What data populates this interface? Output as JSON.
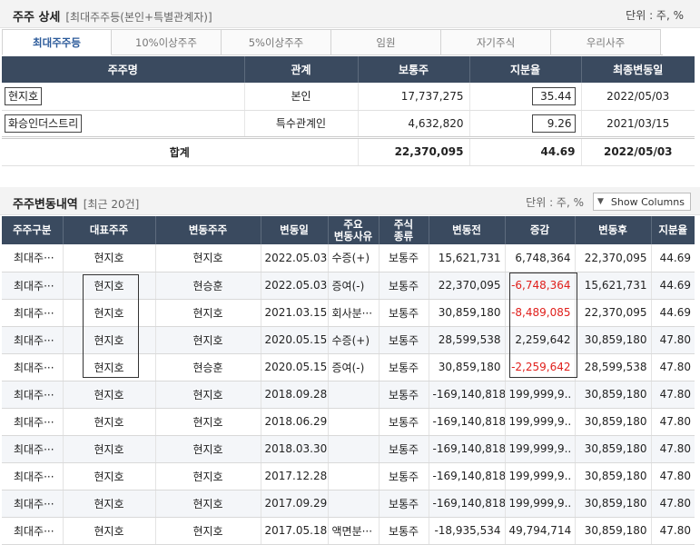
{
  "summary": {
    "title": "주주 상세",
    "subtitle": "[최대주주등(본인+특별관계자)]",
    "unit": "단위 : 주, %",
    "tabs": [
      "최대주주등",
      "10%이상주주",
      "5%이상주주",
      "임원",
      "자기주식",
      "우리사주"
    ],
    "columns": [
      "주주명",
      "관계",
      "보통주",
      "지분율",
      "최종변동일"
    ],
    "rows": [
      {
        "name": "현지호",
        "relation": "본인",
        "common": "17,737,275",
        "share": "35.44",
        "last_change": "2022/05/03"
      },
      {
        "name": "화승인더스트리",
        "relation": "특수관계인",
        "common": "4,632,820",
        "share": "9.26",
        "last_change": "2021/03/15"
      }
    ],
    "total": {
      "label": "합계",
      "common": "22,370,095",
      "share": "44.69",
      "last_change": "2022/05/03"
    }
  },
  "history": {
    "title": "주주변동내역",
    "subtitle": "[최근 20건]",
    "unit": "단위 : 주, %",
    "show_columns_label": "Show Columns",
    "columns": [
      "주주구분",
      "대표주주",
      "변동주주",
      "변동일",
      "주요\n변동사유",
      "주식\n종류",
      "변동전",
      "증감",
      "변동후",
      "지분율"
    ],
    "rows": [
      {
        "type": "최대주···",
        "rep": "현지호",
        "changer": "현지호",
        "date": "2022.05.03",
        "reason": "수증(+)",
        "kind": "보통주",
        "before": "15,621,731",
        "delta": "6,748,364",
        "after": "22,370,095",
        "share": "44.69"
      },
      {
        "type": "최대주···",
        "rep": "현지호",
        "changer": "현승훈",
        "date": "2022.05.03",
        "reason": "증여(-)",
        "kind": "보통주",
        "before": "22,370,095",
        "delta": "-6,748,364",
        "after": "15,621,731",
        "share": "44.69"
      },
      {
        "type": "최대주···",
        "rep": "현지호",
        "changer": "현지호",
        "date": "2021.03.15",
        "reason": "회사분···",
        "kind": "보통주",
        "before": "30,859,180",
        "delta": "-8,489,085",
        "after": "22,370,095",
        "share": "44.69"
      },
      {
        "type": "최대주···",
        "rep": "현지호",
        "changer": "현지호",
        "date": "2020.05.15",
        "reason": "수증(+)",
        "kind": "보통주",
        "before": "28,599,538",
        "delta": "2,259,642",
        "after": "30,859,180",
        "share": "47.80"
      },
      {
        "type": "최대주···",
        "rep": "현지호",
        "changer": "현승훈",
        "date": "2020.05.15",
        "reason": "증여(-)",
        "kind": "보통주",
        "before": "30,859,180",
        "delta": "-2,259,642",
        "after": "28,599,538",
        "share": "47.80"
      },
      {
        "type": "최대주···",
        "rep": "현지호",
        "changer": "현지호",
        "date": "2018.09.28",
        "reason": "",
        "kind": "보통주",
        "before": "-169,140,818",
        "delta": "199,999,9..",
        "after": "30,859,180",
        "share": "47.80"
      },
      {
        "type": "최대주···",
        "rep": "현지호",
        "changer": "현지호",
        "date": "2018.06.29",
        "reason": "",
        "kind": "보통주",
        "before": "-169,140,818",
        "delta": "199,999,9..",
        "after": "30,859,180",
        "share": "47.80"
      },
      {
        "type": "최대주···",
        "rep": "현지호",
        "changer": "현지호",
        "date": "2018.03.30",
        "reason": "",
        "kind": "보통주",
        "before": "-169,140,818",
        "delta": "199,999,9..",
        "after": "30,859,180",
        "share": "47.80"
      },
      {
        "type": "최대주···",
        "rep": "현지호",
        "changer": "현지호",
        "date": "2017.12.28",
        "reason": "",
        "kind": "보통주",
        "before": "-169,140,818",
        "delta": "199,999,9..",
        "after": "30,859,180",
        "share": "47.80"
      },
      {
        "type": "최대주···",
        "rep": "현지호",
        "changer": "현지호",
        "date": "2017.09.29",
        "reason": "",
        "kind": "보통주",
        "before": "-169,140,818",
        "delta": "199,999,9..",
        "after": "30,859,180",
        "share": "47.80"
      },
      {
        "type": "최대주···",
        "rep": "현지호",
        "changer": "현지호",
        "date": "2017.05.18",
        "reason": "액면분···",
        "kind": "보통주",
        "before": "-18,935,534",
        "delta": "49,794,714",
        "after": "30,859,180",
        "share": "47.80"
      }
    ]
  },
  "colors": {
    "header_bg": "#3a4a5f",
    "negative": "#e0201c",
    "active_tab": "#2b5a9a"
  }
}
